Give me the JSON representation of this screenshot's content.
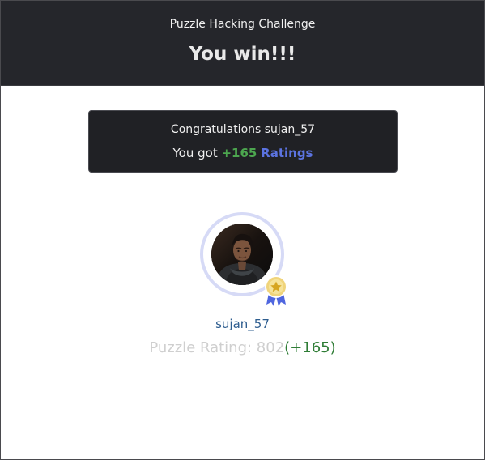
{
  "header": {
    "subtitle": "Puzzle Hacking Challenge",
    "title": "You win!!!"
  },
  "message": {
    "congratulations": "Congratulations sujan_57",
    "result_prefix": "You got",
    "rating_delta": "+165",
    "rating_word": "Ratings"
  },
  "profile": {
    "username": "sujan_57",
    "rating_label": "Puzzle Rating: 802",
    "rating_change": "(+165)",
    "avatar_icon": "user-photo",
    "badge_icon": "star-medal-icon"
  },
  "colors": {
    "header_background": "#25262b",
    "positive": "#4ca64f",
    "accent": "#5b73e0",
    "username": "#2e5d8f",
    "ring": "#d6daf6"
  }
}
